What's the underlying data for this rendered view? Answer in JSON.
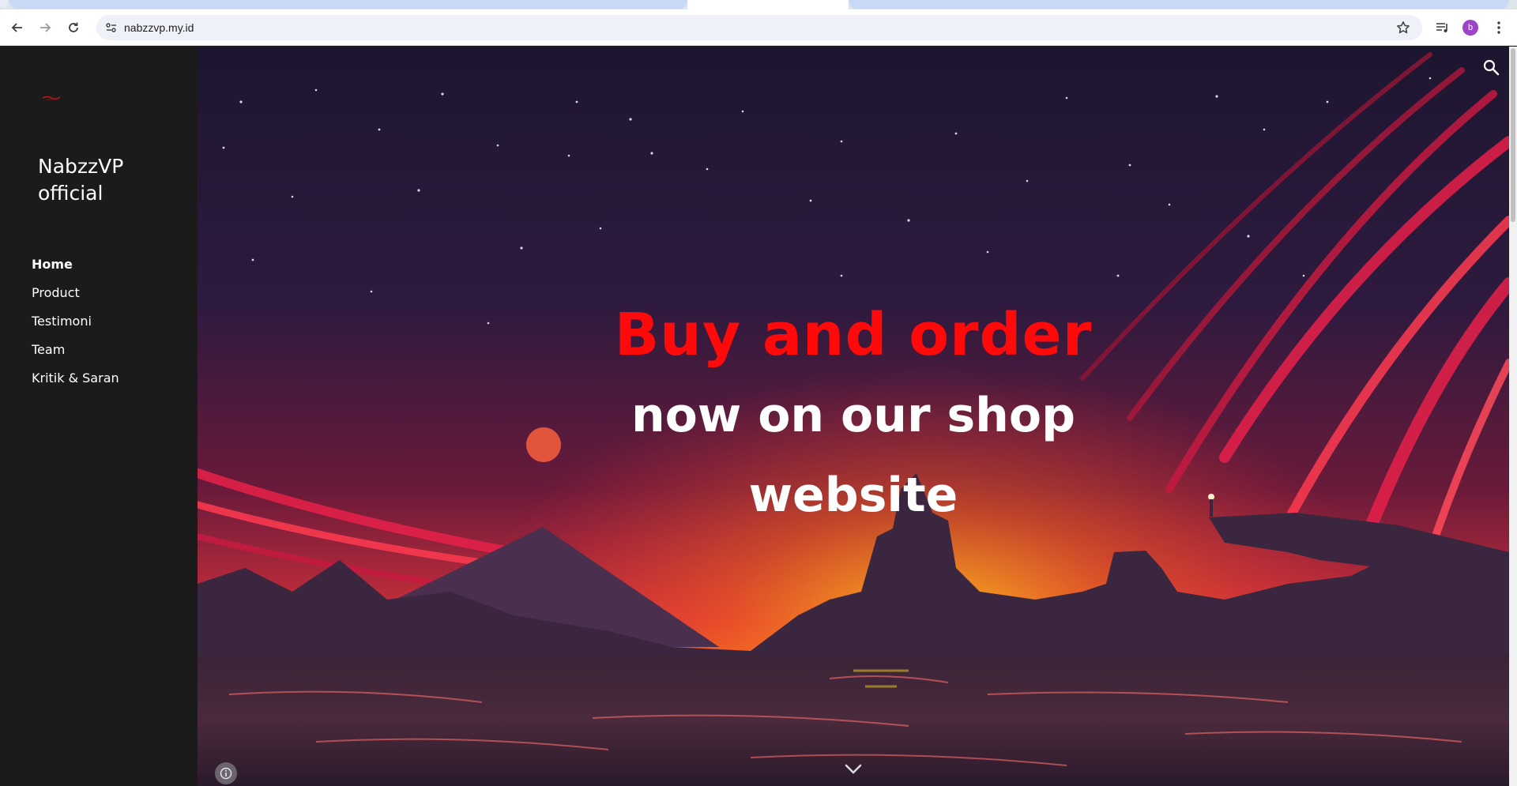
{
  "browser": {
    "url": "nabzzvp.my.id",
    "profile_initial": "b",
    "icons": [
      "back-arrow-icon",
      "forward-arrow-icon",
      "reload-icon",
      "site-settings-icon",
      "bookmark-star-icon",
      "media-queue-icon",
      "more-vert-icon"
    ]
  },
  "sidebar": {
    "brand": "NabzzVP official",
    "nav": [
      {
        "label": "Home",
        "active": true
      },
      {
        "label": "Product"
      },
      {
        "label": "Testimoni"
      },
      {
        "label": "Team"
      },
      {
        "label": "Kritik & Saran"
      }
    ]
  },
  "hero": {
    "line1": "Buy and order",
    "line2": "now on our shop",
    "line3": "website",
    "colors": {
      "line1": "#ff0a0a",
      "line2": "#ffffff",
      "sky_top": "#1f1733",
      "accent_red": "#e8204a",
      "sunset_yellow": "#f2d21a"
    },
    "icons": [
      "search-icon",
      "info-icon",
      "chevron-down-icon"
    ]
  }
}
